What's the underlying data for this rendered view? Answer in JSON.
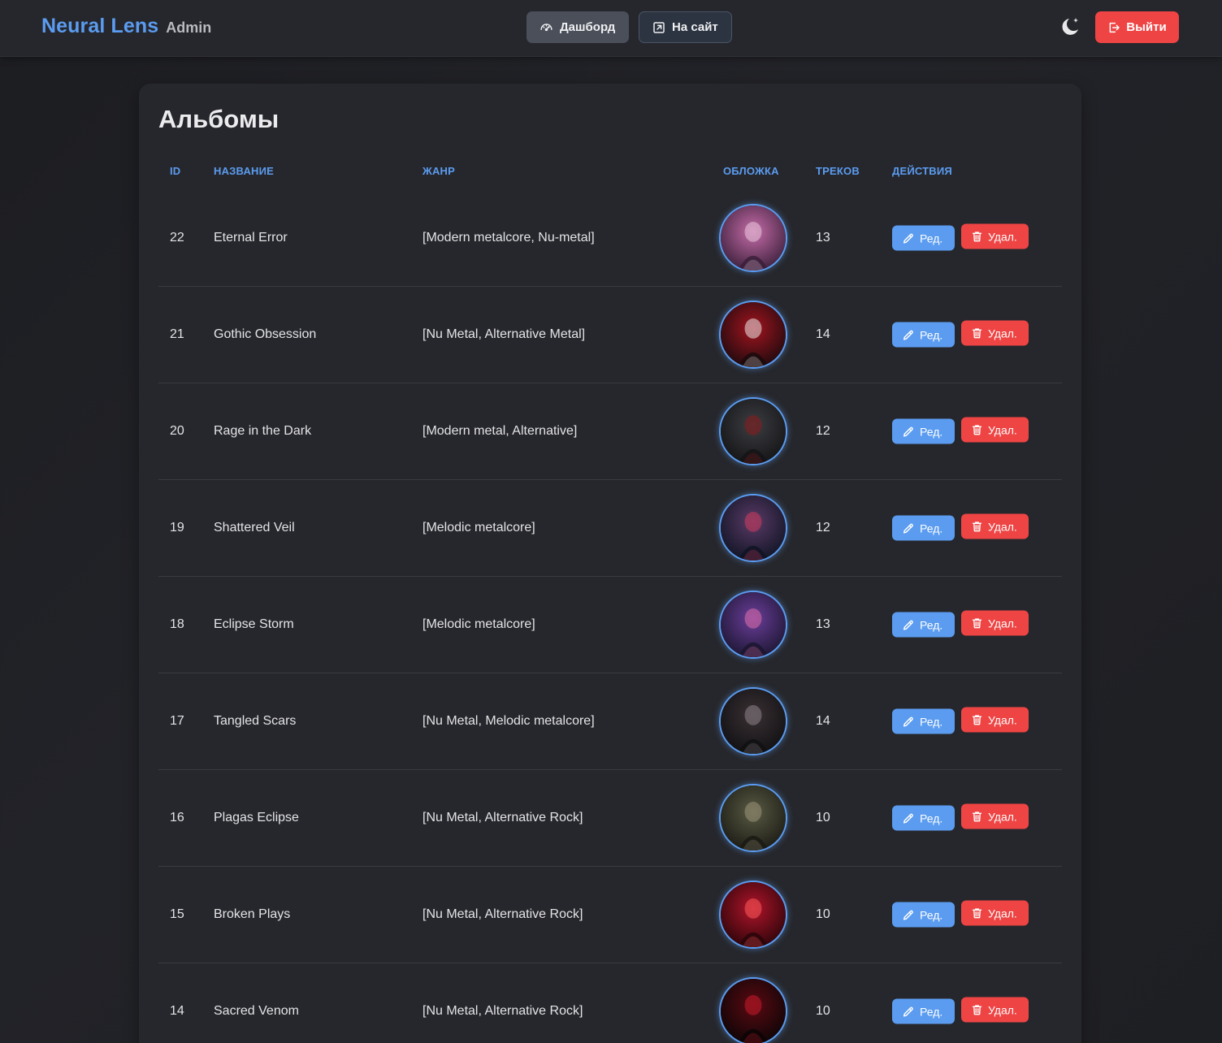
{
  "header": {
    "brand": "Neural Lens",
    "brand_sub": "Admin",
    "nav": {
      "dashboard": "Дашборд",
      "site": "На сайт"
    },
    "logout": "Выйти"
  },
  "page": {
    "title": "Альбомы"
  },
  "table": {
    "headers": {
      "id": "ID",
      "name": "НАЗВАНИЕ",
      "genre": "ЖАНР",
      "cover": "ОБЛОЖКА",
      "tracks": "ТРЕКОВ",
      "actions": "ДЕЙСТВИЯ"
    },
    "edit_label": "Ред.",
    "delete_label": "Удал.",
    "rows": [
      {
        "id": "22",
        "name": "Eternal Error",
        "genre": "[Modern metalcore, Nu-metal]",
        "tracks": "13"
      },
      {
        "id": "21",
        "name": "Gothic Obsession",
        "genre": "[Nu Metal, Alternative Metal]",
        "tracks": "14"
      },
      {
        "id": "20",
        "name": "Rage in the Dark",
        "genre": "[Modern metal, Alternative]",
        "tracks": "12"
      },
      {
        "id": "19",
        "name": "Shattered Veil",
        "genre": "[Melodic metalcore]",
        "tracks": "12"
      },
      {
        "id": "18",
        "name": "Eclipse Storm",
        "genre": "[Melodic metalcore]",
        "tracks": "13"
      },
      {
        "id": "17",
        "name": "Tangled Scars",
        "genre": "[Nu Metal, Melodic metalcore]",
        "tracks": "14"
      },
      {
        "id": "16",
        "name": "Plagas Eclipse",
        "genre": "[Nu Metal, Alternative Rock]",
        "tracks": "10"
      },
      {
        "id": "15",
        "name": "Broken Plays",
        "genre": "[Nu Metal, Alternative Rock]",
        "tracks": "10"
      },
      {
        "id": "14",
        "name": "Sacred Venom",
        "genre": "[Nu Metal, Alternative Rock]",
        "tracks": "10"
      }
    ]
  },
  "colors": {
    "accent": "#5b9cf0",
    "danger": "#ef4444",
    "background": "#1e1f23",
    "card": "#26272c"
  },
  "icons": {
    "dashboard": "gauge-icon",
    "site": "external-link-icon",
    "theme": "moon-stars-icon",
    "logout": "logout-icon",
    "edit": "pencil-icon",
    "delete": "trash-icon"
  }
}
